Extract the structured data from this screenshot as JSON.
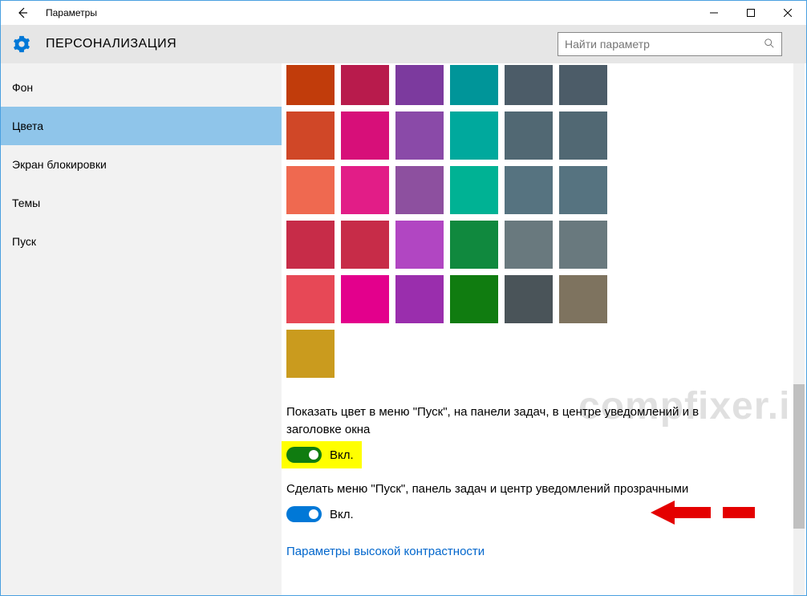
{
  "titlebar": {
    "title": "Параметры"
  },
  "header": {
    "section": "ПЕРСОНАЛИЗАЦИЯ",
    "search_placeholder": "Найти параметр"
  },
  "sidebar": {
    "items": [
      "Фон",
      "Цвета",
      "Экран блокировки",
      "Темы",
      "Пуск"
    ],
    "active_index": 1
  },
  "palette": {
    "rows": [
      [
        "#c13c0b",
        "#b81b4c",
        "#7c3a9e",
        "#009599",
        "#4c5c68",
        "#4c5c68"
      ],
      [
        "#d04727",
        "#d70f79",
        "#8a4aa8",
        "#00a99d",
        "#516873",
        "#516873"
      ],
      [
        "#ef6950",
        "#e21d87",
        "#8d509f",
        "#00b294",
        "#567380",
        "#567380"
      ],
      [
        "#c72c48",
        "#c72c48",
        "#b146c2",
        "#10893e",
        "#69797e",
        "#69797e"
      ],
      [
        "#e74856",
        "#e3008c",
        "#9a2ead",
        "#107c10",
        "#4a5459",
        "#7e735f"
      ]
    ],
    "extra": "#ca9b1e"
  },
  "options": {
    "opt1_label": "Показать цвет в меню \"Пуск\", на панели задач, в центре уведомлений и в заголовке окна",
    "opt1_state": "Вкл.",
    "opt2_label": "Сделать меню \"Пуск\", панель задач и центр уведомлений прозрачными",
    "opt2_state": "Вкл.",
    "link": "Параметры высокой контрастности"
  },
  "watermark": "compfixer.info"
}
